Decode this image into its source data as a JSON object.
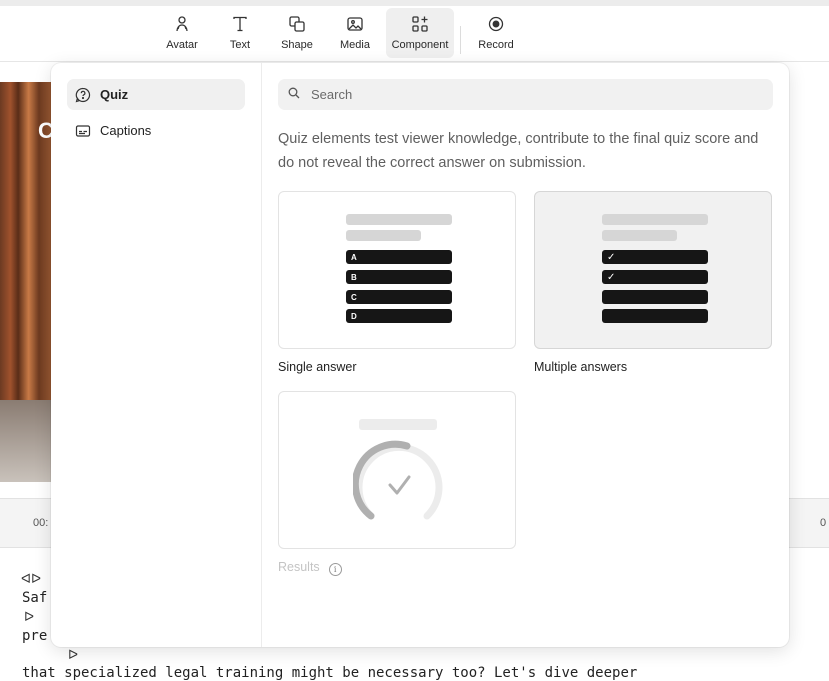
{
  "toolbar": {
    "items": [
      {
        "label": "Avatar",
        "icon": "avatar-icon"
      },
      {
        "label": "Text",
        "icon": "text-icon"
      },
      {
        "label": "Shape",
        "icon": "shape-icon"
      },
      {
        "label": "Media",
        "icon": "media-icon"
      },
      {
        "label": "Component",
        "icon": "component-icon",
        "active": true
      },
      {
        "label": "Record",
        "icon": "record-icon"
      }
    ]
  },
  "background": {
    "timeline_left": "00:",
    "timeline_right": "0",
    "script_lines": [
      "Saf",
      "pre",
      "that specialized legal training might be necessary too? Let's dive deeper"
    ]
  },
  "sidebar": {
    "items": [
      {
        "label": "Quiz",
        "icon": "quiz-icon",
        "active": true
      },
      {
        "label": "Captions",
        "icon": "captions-icon"
      }
    ]
  },
  "search": {
    "placeholder": "Search",
    "value": ""
  },
  "description": "Quiz elements test viewer knowledge, contribute to the final quiz score and do not reveal the correct answer on submission.",
  "cards": [
    {
      "label": "Single answer",
      "options": [
        "A",
        "B",
        "C",
        "D"
      ],
      "selected": false
    },
    {
      "label": "Multiple answers",
      "options": [
        "✓",
        "✓",
        "",
        ""
      ],
      "selected": true
    },
    {
      "label": "Results",
      "disabled": true,
      "icon": "results-gauge-icon"
    }
  ],
  "colors": {
    "accent_dark": "#161616",
    "panel_bg": "#ffffff",
    "selected_bg": "#f1f1f1"
  }
}
